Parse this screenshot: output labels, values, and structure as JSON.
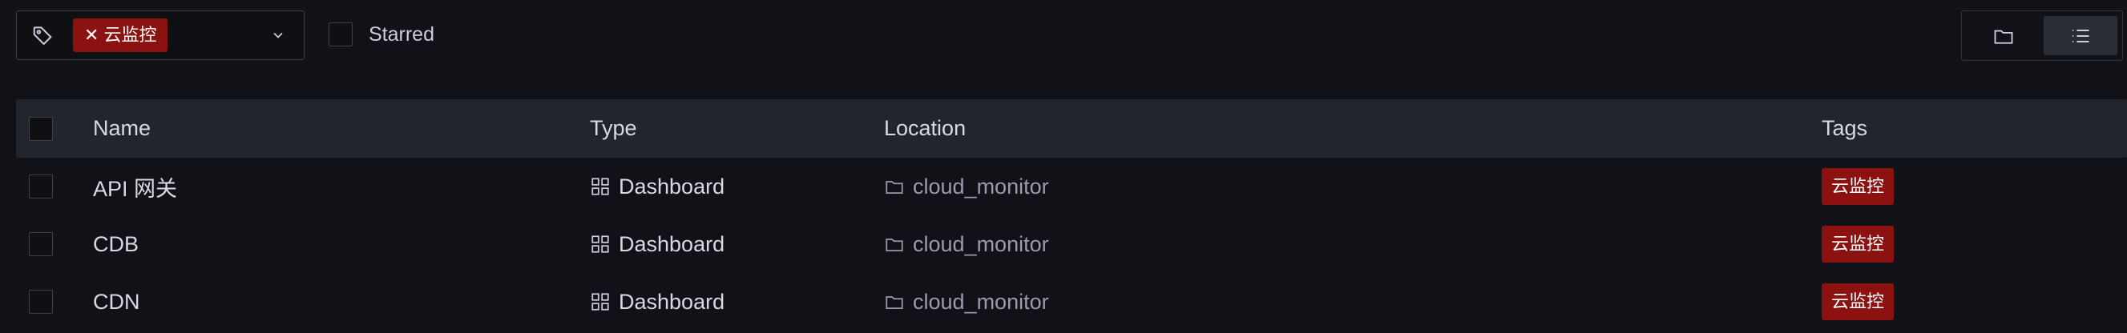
{
  "toolbar": {
    "tag_filter": {
      "chip_label": "云监控",
      "remove_glyph": "✕",
      "icon": "tag-icon",
      "dropdown_icon": "chevron-down-icon"
    },
    "starred_label": "Starred",
    "view_modes": [
      {
        "icon": "folder-icon",
        "active": false
      },
      {
        "icon": "list-icon",
        "active": true
      }
    ]
  },
  "table": {
    "headers": {
      "name": "Name",
      "type": "Type",
      "location": "Location",
      "tags": "Tags"
    },
    "rows": [
      {
        "name": "API 网关",
        "type": "Dashboard",
        "location": "cloud_monitor",
        "tag": "云监控"
      },
      {
        "name": "CDB",
        "type": "Dashboard",
        "location": "cloud_monitor",
        "tag": "云监控"
      },
      {
        "name": "CDN",
        "type": "Dashboard",
        "location": "cloud_monitor",
        "tag": "云监控"
      }
    ]
  },
  "colors": {
    "background": "#111217",
    "header_row": "#22252b",
    "tag": "#8c1111"
  }
}
